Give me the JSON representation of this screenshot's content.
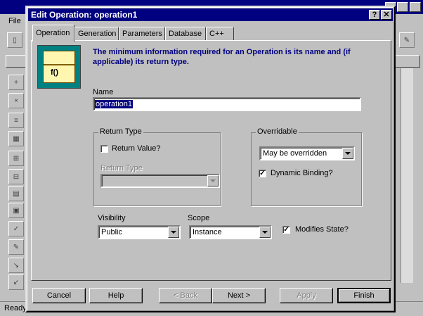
{
  "app": {
    "menu_file": "File",
    "status_text": "Ready"
  },
  "dialog": {
    "title": "Edit Operation: operation1",
    "help_glyph": "?",
    "close_glyph": "✕"
  },
  "tabs": [
    {
      "label": "Operation",
      "active": true
    },
    {
      "label": "Generation"
    },
    {
      "label": "Parameters"
    },
    {
      "label": "Database"
    },
    {
      "label": "C++"
    }
  ],
  "info_text": "The minimum information required for an Operation is its name and (if applicable) its return type.",
  "icon_text": "f()",
  "name": {
    "label": "Name",
    "value": "operation1"
  },
  "return_type": {
    "group_label": "Return Type",
    "checkbox_label": "Return Value?",
    "checked": false,
    "type_label": "Return Type",
    "type_value": ""
  },
  "overridable": {
    "group_label": "Overridable",
    "value": "May be overridden",
    "dynamic_binding_label": "Dynamic Binding?",
    "dynamic_binding_checked": true
  },
  "visibility": {
    "label": "Visibility",
    "value": "Public"
  },
  "scope": {
    "label": "Scope",
    "value": "Instance"
  },
  "modifies_state": {
    "label": "Modifies State?",
    "checked": true
  },
  "buttons": {
    "cancel": "Cancel",
    "help": "Help",
    "back": "< Back",
    "next": "Next >",
    "apply": "Apply",
    "finish": "Finish"
  },
  "colors": {
    "titlebar": "#000080",
    "info_text": "#000080",
    "face": "#c0c0c0"
  }
}
